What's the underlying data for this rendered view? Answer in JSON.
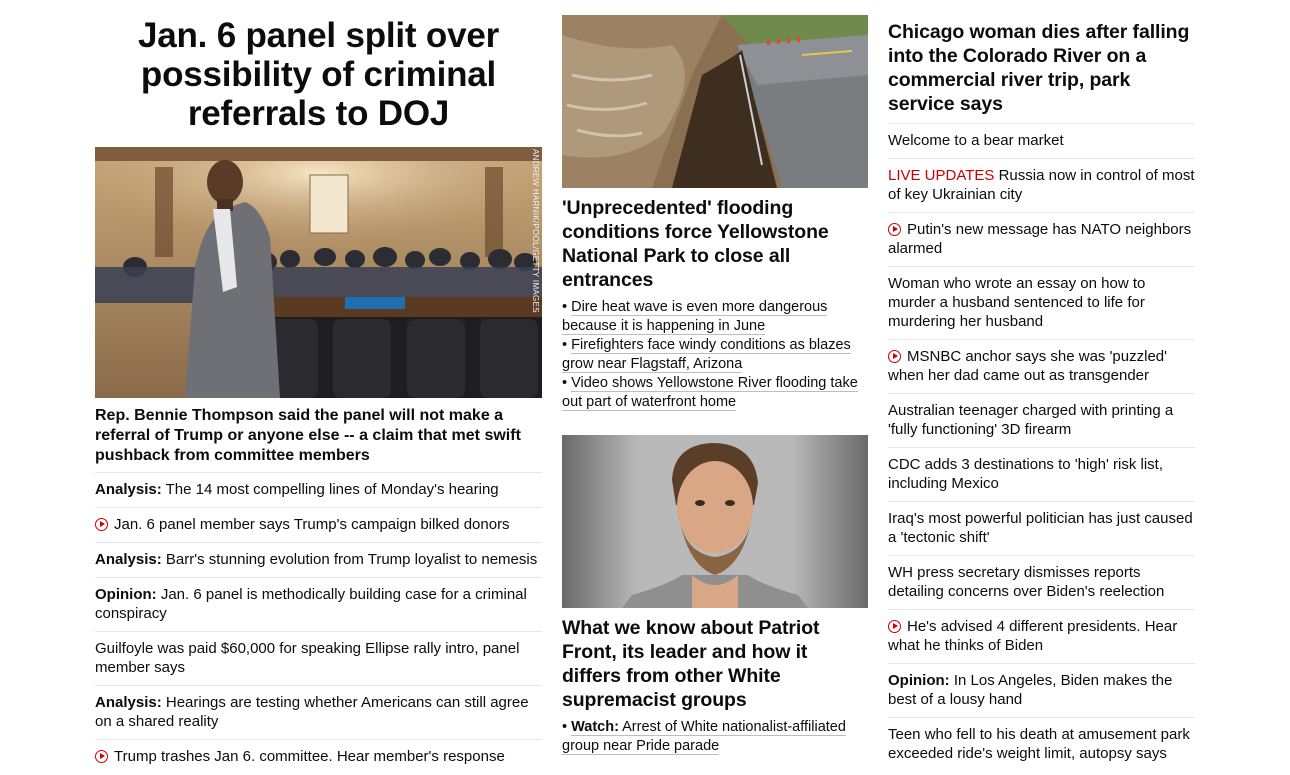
{
  "col1": {
    "headline": "Jan. 6 panel split over possibility of criminal referrals to DOJ",
    "photo_credit": "ANDREW HARNIK/POOL/GETTY IMAGES",
    "caption": "Rep. Bennie Thompson said the panel will not make a referral of Trump or anyone else -- a claim that met swift pushback from committee members",
    "items": [
      {
        "prefix": "Analysis:",
        "text": "The 14 most compelling lines of Monday's hearing"
      },
      {
        "text": "Jan. 6 panel member says Trump's campaign bilked donors",
        "icon": "play-icon"
      },
      {
        "prefix": "Analysis:",
        "text": "Barr's stunning evolution from Trump loyalist to nemesis"
      },
      {
        "prefix": "Opinion:",
        "text": "Jan. 6 panel is methodically building case for a criminal conspiracy"
      },
      {
        "text": "Guilfoyle was paid $60,000 for speaking Ellipse rally intro, panel member says"
      },
      {
        "prefix": "Analysis:",
        "text": "Hearings are testing whether Americans can still agree on a shared reality"
      },
      {
        "text": "Trump trashes Jan 6. committee. Hear member's response",
        "icon": "play-icon"
      }
    ]
  },
  "col2": {
    "story1": {
      "headline": "'Unprecedented' flooding conditions force Yellowstone National Park to close all entrances",
      "bullets": [
        {
          "text": "Dire heat wave is even more dangerous because it is happening in June"
        },
        {
          "text": "Firefighters face windy conditions as blazes grow near Flagstaff, Arizona"
        },
        {
          "text": "Video shows Yellowstone River flooding take out part of waterfront home"
        }
      ]
    },
    "story2": {
      "headline": "What we know about Patriot Front, its leader and how it differs from other White supremacist groups",
      "bullets": [
        {
          "prefix": "Watch:",
          "text": "Arrest of White nationalist-affiliated group near Pride parade"
        }
      ]
    }
  },
  "col3": {
    "headline": "Chicago woman dies after falling into the Colorado River on a commercial river trip, park service says",
    "items": [
      {
        "text": "Welcome to a bear market"
      },
      {
        "live": "LIVE UPDATES",
        "text": "Russia now in control of most of key Ukrainian city"
      },
      {
        "text": "Putin's new message has NATO neighbors alarmed",
        "icon": "play-icon"
      },
      {
        "text": "Woman who wrote an essay on how to murder a husband sentenced to life for murdering her husband"
      },
      {
        "text": "MSNBC anchor says she was 'puzzled' when her dad came out as transgender",
        "icon": "play-icon"
      },
      {
        "text": "Australian teenager charged with printing a 'fully functioning' 3D firearm"
      },
      {
        "text": "CDC adds 3 destinations to 'high' risk list, including Mexico"
      },
      {
        "text": "Iraq's most powerful politician has just caused a 'tectonic shift'"
      },
      {
        "text": "WH press secretary dismisses reports detailing concerns over Biden's reelection"
      },
      {
        "text": "He's advised 4 different presidents. Hear what he thinks of Biden",
        "icon": "play-icon"
      },
      {
        "prefix": "Opinion:",
        "text": "In Los Angeles, Biden makes the best of a lousy hand"
      },
      {
        "text": "Teen who fell to his death at amusement park exceeded ride's weight limit, autopsy says"
      }
    ]
  },
  "colors": {
    "live_red": "#cc0000",
    "divider": "#e6e6e6",
    "text": "#0c0c0c"
  }
}
